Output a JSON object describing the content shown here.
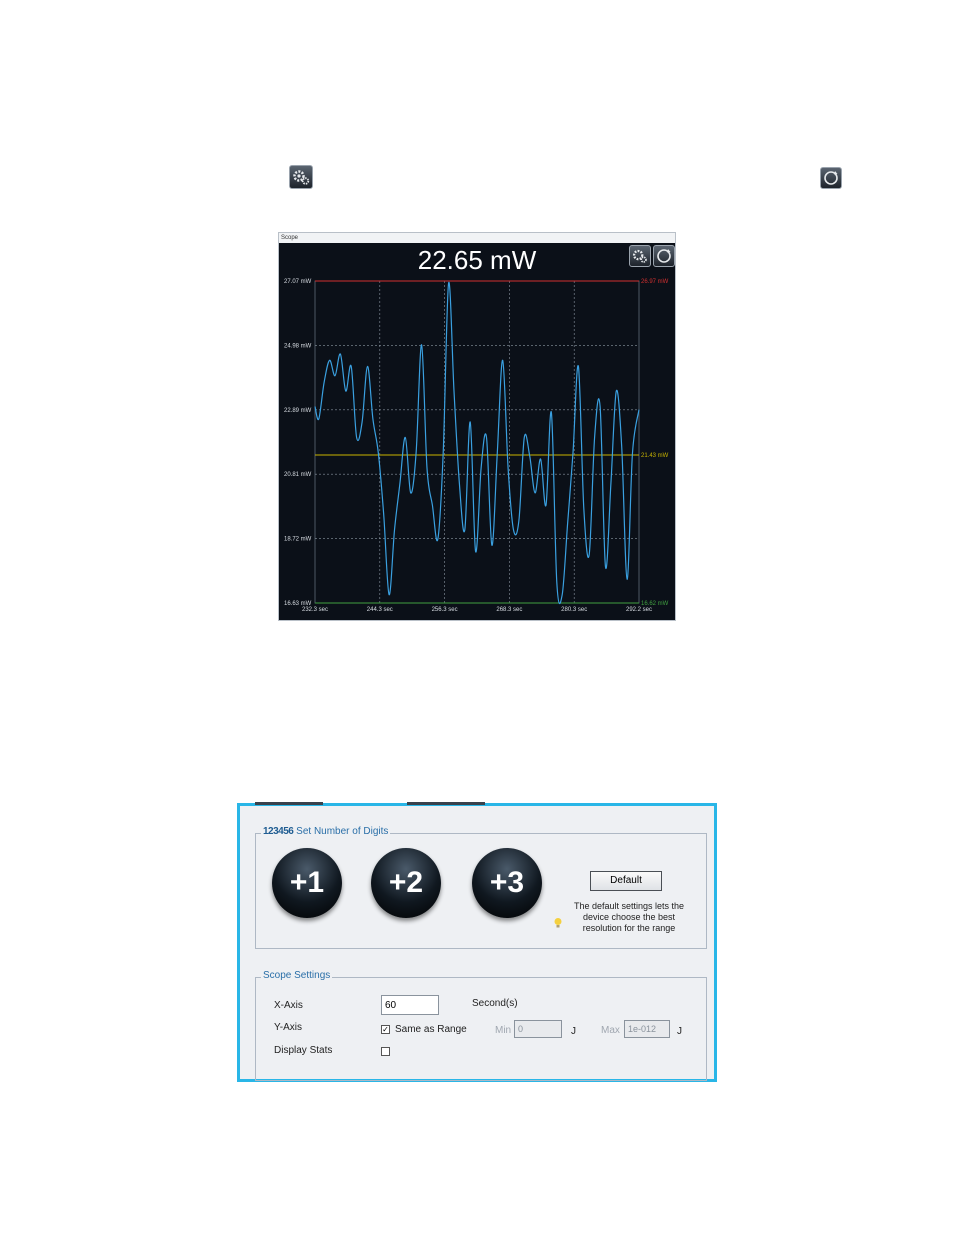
{
  "top_icons": {
    "settings": "gear-icon",
    "refresh": "refresh-icon"
  },
  "scope": {
    "title": "Scope",
    "reading": "22.65 mW",
    "y_ticks": [
      "27.07 mW",
      "24.98 mW",
      "22.89 mW",
      "20.81 mW",
      "18.72 mW",
      "16.63 mW"
    ],
    "x_ticks": [
      "232.3 sec",
      "244.3 sec",
      "256.3 sec",
      "268.3 sec",
      "280.3 sec",
      "292.2 sec"
    ],
    "max_label": "26.97 mW",
    "avg_label": "21.43 mW",
    "min_label": "16.62 mW",
    "colors": {
      "trace": "#3aa0e0",
      "max": "#d23030",
      "avg": "#c8b400",
      "min": "#40a040",
      "grid": "#8a95a0"
    }
  },
  "chart_data": {
    "type": "line",
    "xlabel": "",
    "ylabel": "",
    "ylim": [
      16.63,
      27.07
    ],
    "xlim": [
      232.3,
      292.2
    ],
    "series": [
      {
        "x": [
          232.3,
          233,
          234,
          235,
          236,
          237,
          238,
          239,
          240,
          241,
          242,
          243,
          244,
          245,
          246,
          247,
          248,
          249,
          250,
          251,
          252,
          253,
          254,
          255,
          256,
          257,
          258,
          259,
          260,
          261,
          262,
          263,
          264,
          265,
          266,
          267,
          268,
          269,
          270,
          271,
          272,
          273,
          274,
          275,
          276,
          277,
          278,
          279,
          280,
          281,
          282,
          283,
          284,
          285,
          286,
          287,
          288,
          289,
          290,
          291,
          292.2
        ],
        "y": [
          23.0,
          22.6,
          23.8,
          24.5,
          24.0,
          24.7,
          23.5,
          24.3,
          22.0,
          22.5,
          24.3,
          22.6,
          21.5,
          19.5,
          16.9,
          19.0,
          20.5,
          22.0,
          20.2,
          21.5,
          25.0,
          21.0,
          19.8,
          18.7,
          21.5,
          27.0,
          23.5,
          20.5,
          19.0,
          22.5,
          18.3,
          21.0,
          22.0,
          18.5,
          21.5,
          24.5,
          21.0,
          19.0,
          19.3,
          22.0,
          21.4,
          20.2,
          21.3,
          19.8,
          22.8,
          17.3,
          16.9,
          19.2,
          21.5,
          24.3,
          19.7,
          18.2,
          22.0,
          23.0,
          17.8,
          20.5,
          23.5,
          21.7,
          17.4,
          21.5,
          22.9
        ]
      }
    ]
  },
  "panel": {
    "digits_logo": "123456",
    "digits_title": "Set Number of Digits",
    "btn_plus1": "+1",
    "btn_plus2": "+2",
    "btn_plus3": "+3",
    "default_label": "Default",
    "default_hint": "The default settings lets the device choose the best resolution for the range",
    "scope_title": "Scope Settings",
    "x_axis_label": "X-Axis",
    "x_axis_value": "60",
    "x_axis_unit": "Second(s)",
    "y_axis_label": "Y-Axis",
    "same_as_range_label": "Same as Range",
    "same_as_range_checked": true,
    "min_label": "Min",
    "min_value": "0",
    "min_unit": "J",
    "max_label": "Max",
    "max_value": "1e-012",
    "max_unit": "J",
    "display_stats_label": "Display Stats",
    "display_stats_checked": false,
    "hint_icon": "lightbulb-icon"
  }
}
